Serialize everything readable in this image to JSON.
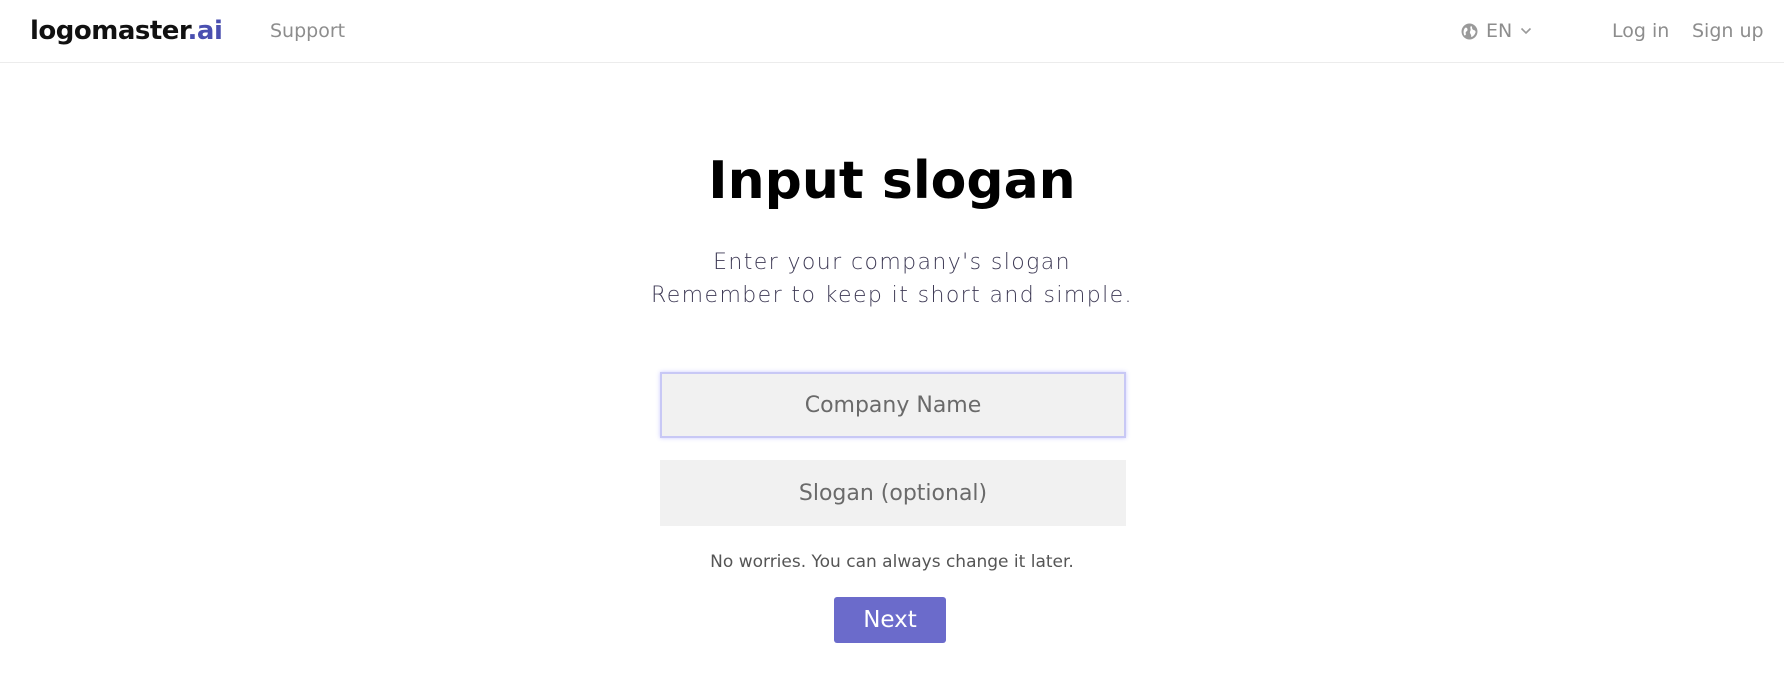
{
  "header": {
    "logo_main": "logomaster",
    "logo_accent": ".ai",
    "support_label": "Support",
    "language": "EN",
    "login_label": "Log in",
    "signup_label": "Sign up"
  },
  "main": {
    "title": "Input slogan",
    "subtitle_line1": "Enter your company's slogan",
    "subtitle_line2": "Remember to keep it short and simple.",
    "company_name_placeholder": "Company Name",
    "company_name_value": "",
    "slogan_placeholder": "Slogan (optional)",
    "slogan_value": "",
    "hint": "No worries. You can always change it later.",
    "next_label": "Next"
  },
  "colors": {
    "accent": "#6b6bcb",
    "logo_accent": "#4a4fb0",
    "input_bg": "#f1f1f1",
    "nav_text": "#8d8d8d"
  },
  "icons": {
    "language": "globe-icon",
    "dropdown": "chevron-down-icon"
  }
}
